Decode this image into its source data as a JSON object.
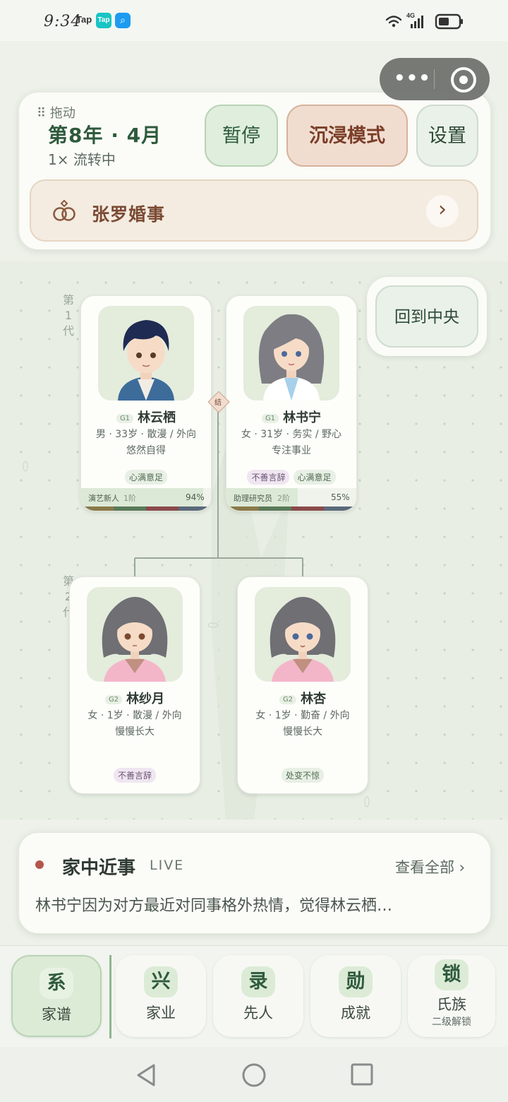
{
  "status_bar": {
    "time": "9:34",
    "app_badge_1": "Tap",
    "app_badge_2": "Tap",
    "network": "4G"
  },
  "header": {
    "drag_label": "⠿ 拖动",
    "year_month": "第8年 · 4月",
    "speed": "1× 流转中",
    "pause_label": "暂停",
    "immersive_label": "沉浸模式",
    "settings_label": "设置",
    "event_label": "张罗婚事",
    "event_arrow": "›"
  },
  "recenter_label": "回到中央",
  "generations": {
    "gen1": [
      "第",
      "1",
      "代"
    ],
    "gen2": [
      "第",
      "2",
      "代"
    ]
  },
  "marriage_link_glyph": "结",
  "members": [
    {
      "gen_badge": "G1",
      "name": "林云栖",
      "info": "男 · 33岁 · 散漫 / 外向",
      "mood": "悠然自得",
      "traits": [
        "心满意足"
      ],
      "job": "演艺新人",
      "job_level": "1阶",
      "progress": "94%",
      "progress_value": 0.94
    },
    {
      "gen_badge": "G1",
      "name": "林书宁",
      "info": "女 · 31岁 · 务实 / 野心",
      "mood": "专注事业",
      "traits": [
        "不善言辞",
        "心满意足"
      ],
      "job": "助理研究员",
      "job_level": "2阶",
      "progress": "55%",
      "progress_value": 0.55
    },
    {
      "gen_badge": "G2",
      "name": "林纱月",
      "info": "女 · 1岁 · 散漫 / 外向",
      "mood": "慢慢长大",
      "traits": [
        "不善言辞"
      ]
    },
    {
      "gen_badge": "G2",
      "name": "林杏",
      "info": "女 · 1岁 · 勤奋 / 外向",
      "mood": "慢慢长大",
      "traits": [
        "处变不惊"
      ]
    }
  ],
  "news": {
    "title": "家中近事",
    "live": "LIVE",
    "more": "查看全部 ›",
    "text": "林书宁因为对方最近对同事格外热情，觉得林云栖…"
  },
  "nav": [
    {
      "glyph": "系",
      "label": "家谱",
      "sub": ""
    },
    {
      "glyph": "兴",
      "label": "家业",
      "sub": ""
    },
    {
      "glyph": "录",
      "label": "先人",
      "sub": ""
    },
    {
      "glyph": "勋",
      "label": "成就",
      "sub": ""
    },
    {
      "glyph": "锁",
      "label": "氏族",
      "sub": "二级解锁"
    }
  ],
  "colors": {
    "accent_green": "#2e5a3c",
    "accent_brown": "#7a4a33",
    "live_dot": "#b5554d",
    "card_bg": "#fdfdfa"
  }
}
